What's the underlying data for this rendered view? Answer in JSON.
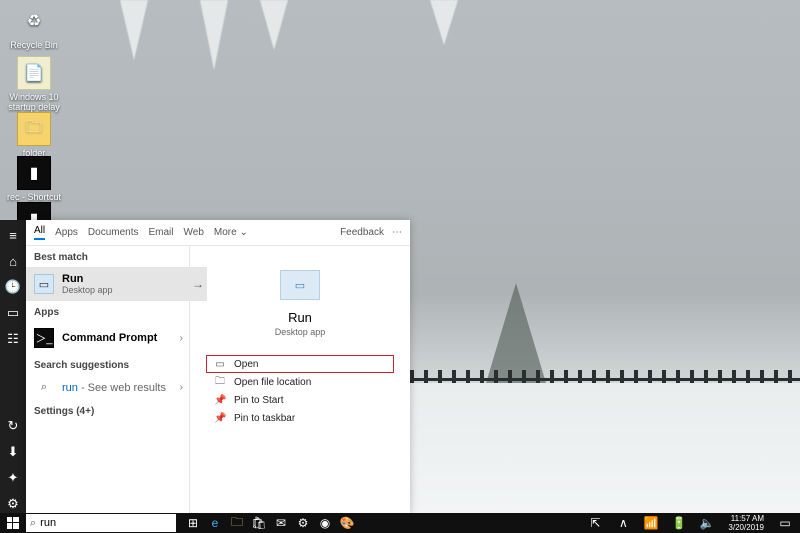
{
  "desktop_icons": [
    {
      "kind": "recycle",
      "label": "Recycle Bin"
    },
    {
      "kind": "note",
      "label": "Windows 10 startup delay"
    },
    {
      "kind": "folder",
      "label": "folder"
    },
    {
      "kind": "cmd",
      "label": "rec - Shortcut"
    },
    {
      "kind": "cmd",
      "label": ""
    }
  ],
  "rail": {
    "items": [
      "≡",
      "⌂",
      "🕒",
      "▭",
      "☷"
    ],
    "bottom": [
      "↻",
      "⬇",
      "✦",
      "⚙"
    ]
  },
  "search": {
    "tabs": [
      "All",
      "Apps",
      "Documents",
      "Email",
      "Web",
      "More"
    ],
    "tabs_more_glyph": "⌄",
    "feedback": "Feedback",
    "ellipsis": "⋯",
    "best_match_label": "Best match",
    "best_match": {
      "title": "Run",
      "subtitle": "Desktop app"
    },
    "apps_label": "Apps",
    "apps": [
      {
        "title": "Command Prompt"
      }
    ],
    "suggestions_label": "Search suggestions",
    "suggestion": {
      "term": "run",
      "hint": " - See web results"
    },
    "settings_label": "Settings (4+)",
    "detail": {
      "title": "Run",
      "subtitle": "Desktop app"
    },
    "actions": [
      "Open",
      "Open file location",
      "Pin to Start",
      "Pin to taskbar"
    ],
    "action_icons": [
      "▭",
      "🗀",
      "📌",
      "📌"
    ]
  },
  "taskbar": {
    "search_value": "run",
    "icons": [
      "⊞",
      "e",
      "🗀",
      "🛍",
      "✉",
      "⚙",
      "◉",
      "🎨"
    ],
    "tray": [
      "⇱",
      "∧",
      "📶",
      "🔋",
      "🔈"
    ],
    "time": "11:57 AM",
    "date": "3/20/2019"
  }
}
